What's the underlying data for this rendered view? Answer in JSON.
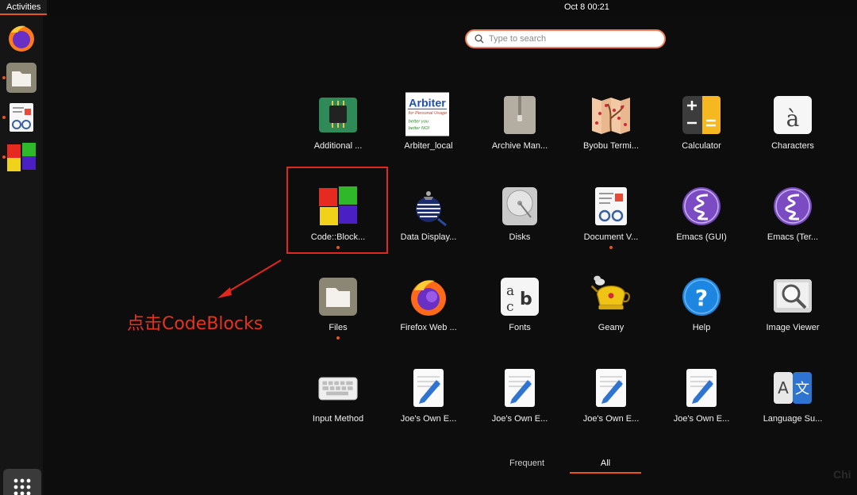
{
  "topbar": {
    "activities_label": "Activities",
    "clock": "Oct 8  00:21"
  },
  "dock": {
    "items": [
      {
        "name": "firefox-icon",
        "running": false
      },
      {
        "name": "files-icon",
        "running": true
      },
      {
        "name": "document-viewer-icon",
        "running": true
      },
      {
        "name": "codeblocks-icon",
        "running": true
      }
    ],
    "show_apps": "show-applications-icon"
  },
  "search": {
    "placeholder": "Type to search"
  },
  "apps": [
    {
      "label": "Additional ...",
      "icon": "chip-icon"
    },
    {
      "label": "Arbiter_local",
      "icon": "arbiter-icon",
      "icon_text_1": "Arbiter",
      "icon_text_2": "for Personal Usage",
      "icon_text_3": "better you",
      "icon_text_4": "better NOI"
    },
    {
      "label": "Archive Man...",
      "icon": "archive-icon"
    },
    {
      "label": "Byobu Termi...",
      "icon": "byobu-icon"
    },
    {
      "label": "Calculator",
      "icon": "calculator-icon"
    },
    {
      "label": "Characters",
      "icon": "characters-icon",
      "icon_text_1": "à"
    },
    {
      "label": "Code::Block...",
      "icon": "codeblocks-icon",
      "running": true
    },
    {
      "label": "Data Display...",
      "icon": "ddd-icon"
    },
    {
      "label": "Disks",
      "icon": "disks-icon"
    },
    {
      "label": "Document V...",
      "icon": "document-viewer-icon",
      "running": true
    },
    {
      "label": "Emacs (GUI)",
      "icon": "emacs-icon"
    },
    {
      "label": "Emacs (Ter...",
      "icon": "emacs-icon"
    },
    {
      "label": "Files",
      "icon": "files-icon",
      "running": true
    },
    {
      "label": "Firefox Web ...",
      "icon": "firefox-icon"
    },
    {
      "label": "Fonts",
      "icon": "fonts-icon"
    },
    {
      "label": "Geany",
      "icon": "geany-icon"
    },
    {
      "label": "Help",
      "icon": "help-icon",
      "icon_text_1": "?"
    },
    {
      "label": "Image Viewer",
      "icon": "image-viewer-icon"
    },
    {
      "label": "Input Method",
      "icon": "keyboard-icon"
    },
    {
      "label": "Joe's Own E...",
      "icon": "text-editor-icon"
    },
    {
      "label": "Joe's Own E...",
      "icon": "text-editor-icon"
    },
    {
      "label": "Joe's Own E...",
      "icon": "text-editor-icon"
    },
    {
      "label": "Joe's Own E...",
      "icon": "text-editor-icon"
    },
    {
      "label": "Language Su...",
      "icon": "language-icon",
      "icon_text_1": "A",
      "icon_text_2": "文"
    }
  ],
  "annotation": {
    "text": "点击CodeBlocks",
    "color": "#e8321f"
  },
  "tabs": {
    "frequent": "Frequent",
    "all": "All",
    "active": "All"
  },
  "watermark": "Chi",
  "colors": {
    "accent": "#e95420",
    "highlight": "#e0281f"
  }
}
